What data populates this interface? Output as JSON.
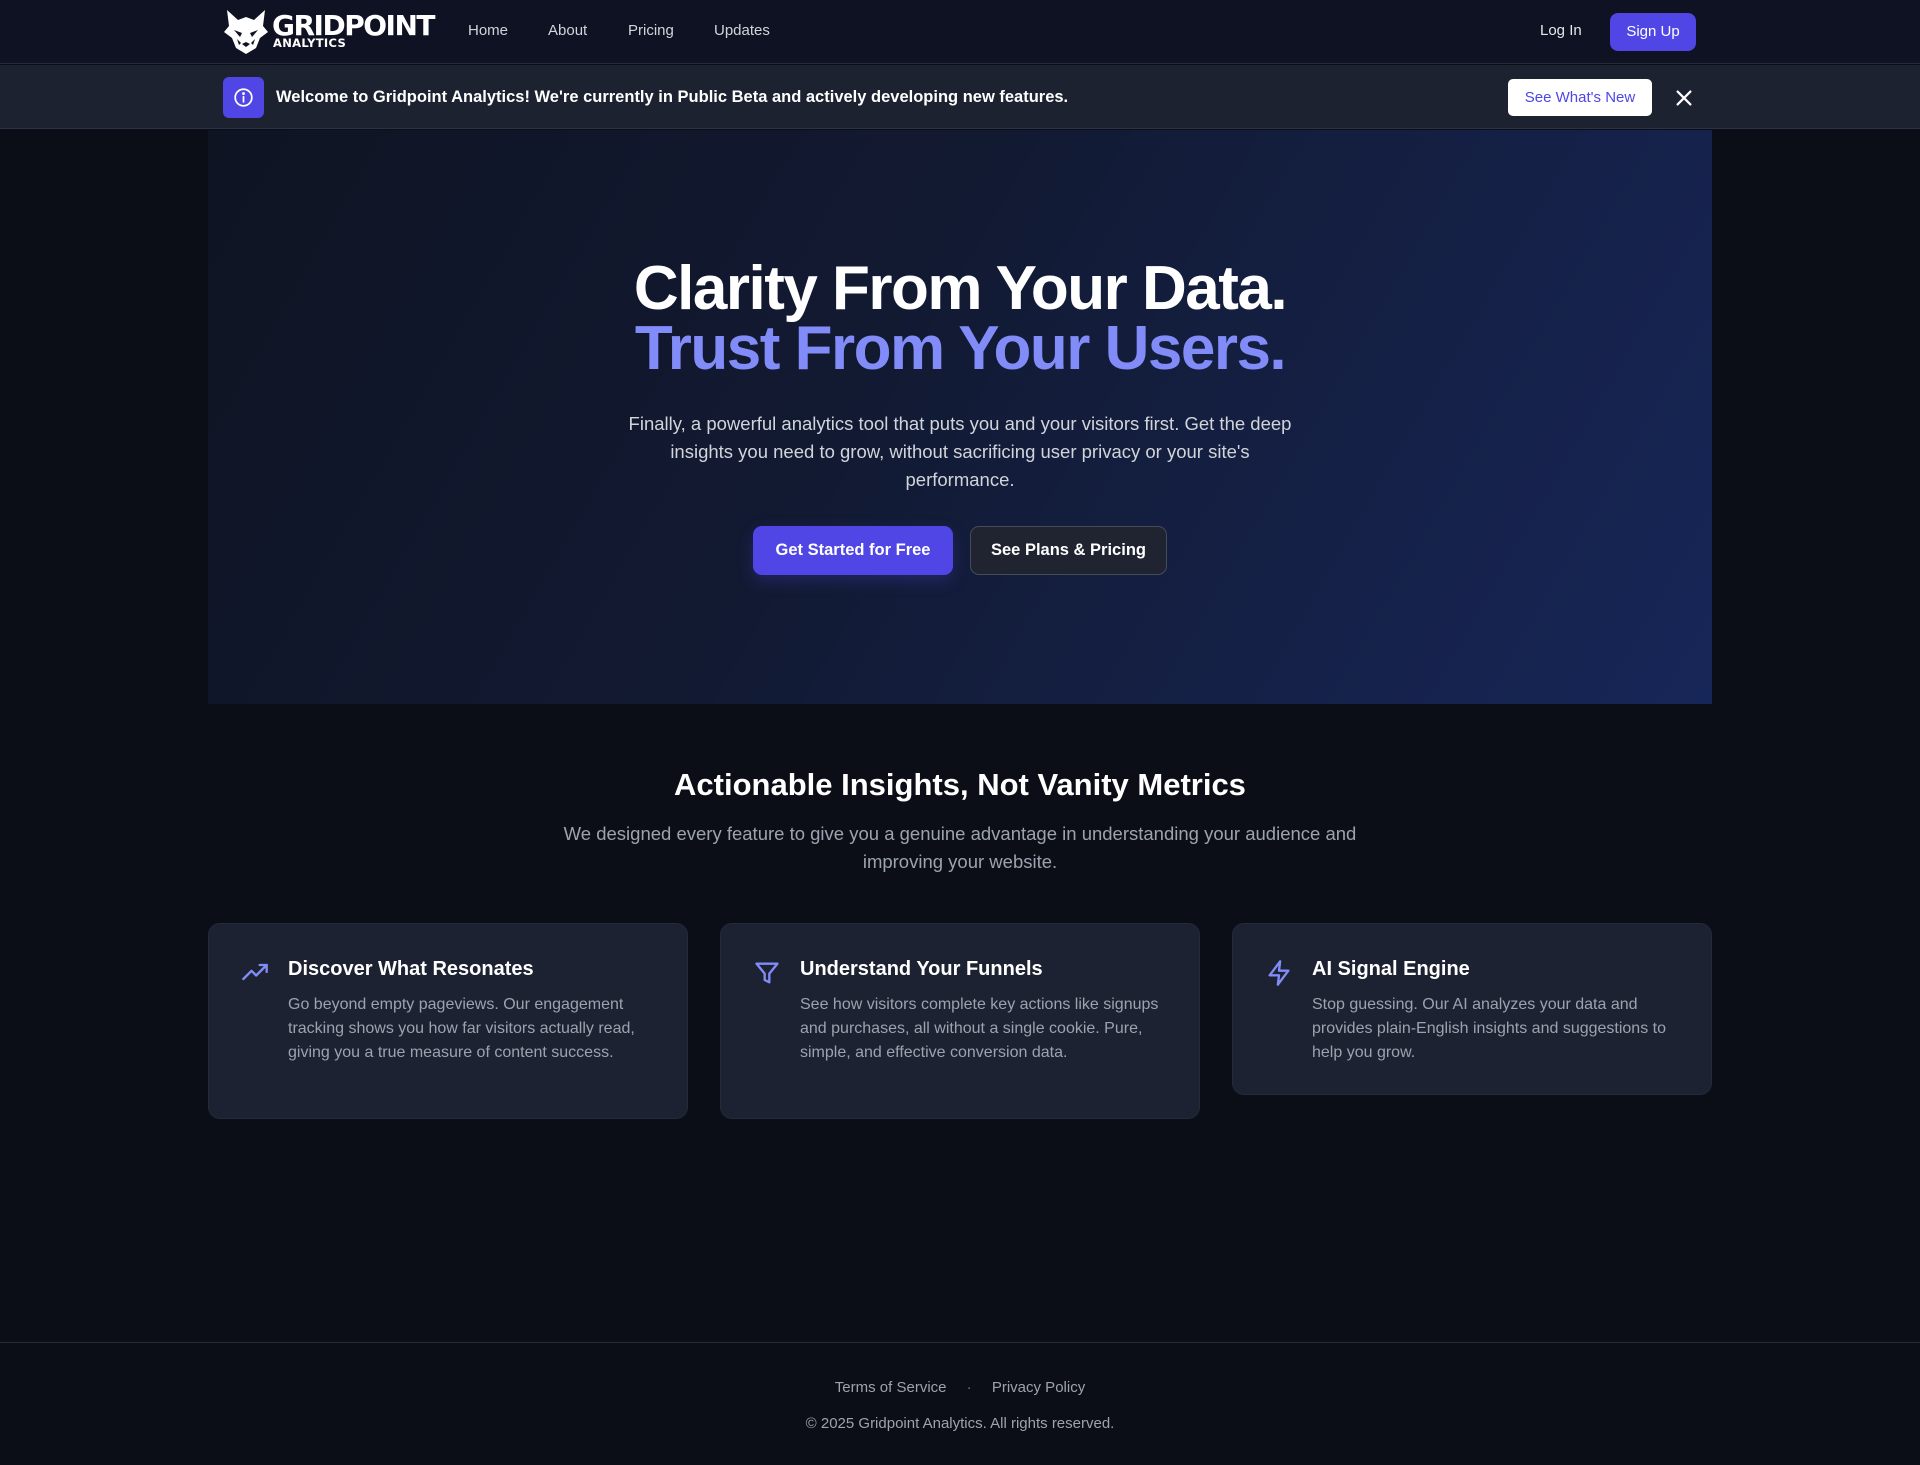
{
  "brand": {
    "name": "GRIDPOINT",
    "subtitle": "ANALYTICS",
    "accent_color": "#4f46e5",
    "highlight_color": "#818cf8"
  },
  "nav": {
    "links": [
      "Home",
      "About",
      "Pricing",
      "Updates"
    ],
    "login_label": "Log In",
    "signup_label": "Sign Up"
  },
  "banner": {
    "icon": "info-icon",
    "text": "Welcome to Gridpoint Analytics! We're currently in Public Beta and actively developing new features.",
    "button_label": "See What's New",
    "close_icon": "close-icon"
  },
  "hero": {
    "title_line1": "Clarity From Your Data.",
    "title_line2": "Trust From Your Users.",
    "subtitle": "Finally, a powerful analytics tool that puts you and your visitors first. Get the deep insights you need to grow, without sacrificing user privacy or your site's performance.",
    "primary_cta": "Get Started for Free",
    "secondary_cta": "See Plans & Pricing"
  },
  "features": {
    "title": "Actionable Insights, Not Vanity Metrics",
    "subtitle": "We designed every feature to give you a genuine advantage in understanding your audience and improving your website.",
    "items": [
      {
        "icon": "trending-up-icon",
        "title": "Discover What Resonates",
        "description": "Go beyond empty pageviews. Our engagement tracking shows you how far visitors actually read, giving you a true measure of content success."
      },
      {
        "icon": "funnel-icon",
        "title": "Understand Your Funnels",
        "description": "See how visitors complete key actions like signups and purchases, all without a single cookie. Pure, simple, and effective conversion data."
      },
      {
        "icon": "lightning-icon",
        "title": "AI Signal Engine",
        "description": "Stop guessing. Our AI analyzes your data and provides plain-English insights and suggestions to help you grow."
      }
    ]
  },
  "footer": {
    "terms_label": "Terms of Service",
    "separator": "·",
    "privacy_label": "Privacy Policy",
    "copyright": "© 2025 Gridpoint Analytics. All rights reserved."
  }
}
